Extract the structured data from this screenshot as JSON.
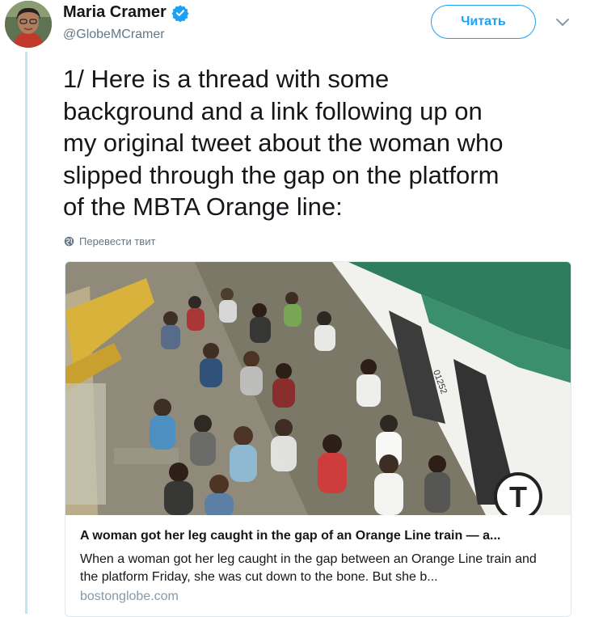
{
  "author": {
    "name": "Maria Cramer",
    "handle": "@GlobeMCramer",
    "verified": true
  },
  "follow_label": "Читать",
  "menu_icon": "chevron-down-icon",
  "tweet": {
    "lines": [
      "1/ Here is a thread with some",
      "background and a link following up on",
      "my original tweet about the woman who",
      "slipped through the gap on the platform",
      "of the MBTA Orange line:"
    ]
  },
  "translate_label": "Перевести твит",
  "card": {
    "title": "A woman got her leg caught in the gap of an Orange Line train — a...",
    "description": "When a woman got her leg caught in the gap between an Orange Line train and the platform Friday, she was cut down to the bone. But she b...",
    "domain": "bostonglobe.com",
    "image_labels": {
      "car_number": "01252",
      "logo_letter": "T"
    }
  },
  "colors": {
    "accent": "#1da1f2",
    "thread_line": "#c4e4f6",
    "secondary_text": "#657786",
    "train_green": "#2e7d5e"
  }
}
